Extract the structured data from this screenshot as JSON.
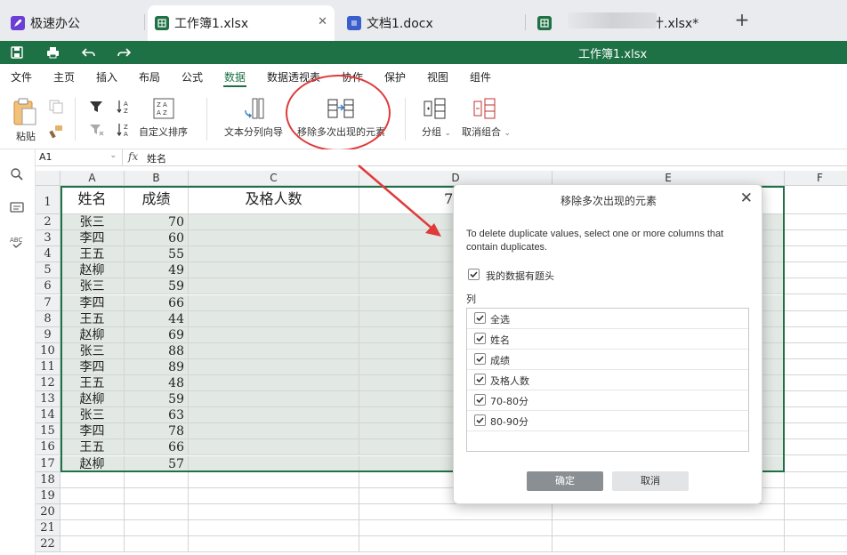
{
  "tabs": [
    {
      "label": "极速办公",
      "icon": "rocket-icon",
      "color": "#6b3fd6"
    },
    {
      "label": "工作簿1.xlsx",
      "icon": "spreadsheet-icon",
      "color": "#1e7145",
      "close": "✕"
    },
    {
      "label": "文档1.docx",
      "icon": "document-icon",
      "color": "#3a5fcd"
    },
    {
      "label": "计.xlsx*",
      "icon": "spreadsheet-icon",
      "color": "#1e7145"
    }
  ],
  "new_tab": "+",
  "window_title": "工作簿1.xlsx",
  "menu": [
    "文件",
    "主页",
    "插入",
    "布局",
    "公式",
    "数据",
    "数据透视表",
    "协作",
    "保护",
    "视图",
    "组件"
  ],
  "active_menu": "数据",
  "ribbon": {
    "paste": "粘贴",
    "custom_sort": "自定义排序",
    "text_to_columns": "文本分列向导",
    "remove_duplicates": "移除多次出现的元素",
    "group": "分组",
    "ungroup": "取消组合",
    "dropdown_caret": "⌄"
  },
  "formula_bar": {
    "cell_ref": "A1",
    "fx": "fx",
    "value": "姓名"
  },
  "grid": {
    "columns": [
      "A",
      "B",
      "C",
      "D",
      "E",
      "F"
    ],
    "headers": [
      "姓名",
      "成绩",
      "及格人数",
      "70-"
    ],
    "rows": [
      [
        "张三",
        "70"
      ],
      [
        "李四",
        "60"
      ],
      [
        "王五",
        "55"
      ],
      [
        "赵柳",
        "49"
      ],
      [
        "张三",
        "59"
      ],
      [
        "李四",
        "66"
      ],
      [
        "王五",
        "44"
      ],
      [
        "赵柳",
        "69"
      ],
      [
        "张三",
        "88"
      ],
      [
        "李四",
        "89"
      ],
      [
        "王五",
        "48"
      ],
      [
        "赵柳",
        "59"
      ],
      [
        "张三",
        "63"
      ],
      [
        "李四",
        "78"
      ],
      [
        "王五",
        "66"
      ],
      [
        "赵柳",
        "57"
      ]
    ],
    "row_numbers": [
      "1",
      "2",
      "3",
      "4",
      "5",
      "6",
      "7",
      "8",
      "9",
      "10",
      "11",
      "12",
      "13",
      "14",
      "15",
      "16",
      "17",
      "18",
      "19",
      "20",
      "21",
      "22"
    ]
  },
  "dialog": {
    "title": "移除多次出现的元素",
    "close": "✕",
    "description": "To delete duplicate values, select one or more columns that contain duplicates.",
    "has_header_label": "我的数据有题头",
    "has_header_checked": true,
    "columns_label": "列",
    "columns": [
      {
        "label": "全选",
        "checked": true
      },
      {
        "label": "姓名",
        "checked": true
      },
      {
        "label": "成绩",
        "checked": true
      },
      {
        "label": "及格人数",
        "checked": true
      },
      {
        "label": "70-80分",
        "checked": true
      },
      {
        "label": "80-90分",
        "checked": true
      }
    ],
    "ok": "确定",
    "cancel": "取消"
  },
  "colors": {
    "brand_green": "#1e7145",
    "annotation_red": "#e03a3a",
    "selection_fill": "#e2e8e4"
  }
}
